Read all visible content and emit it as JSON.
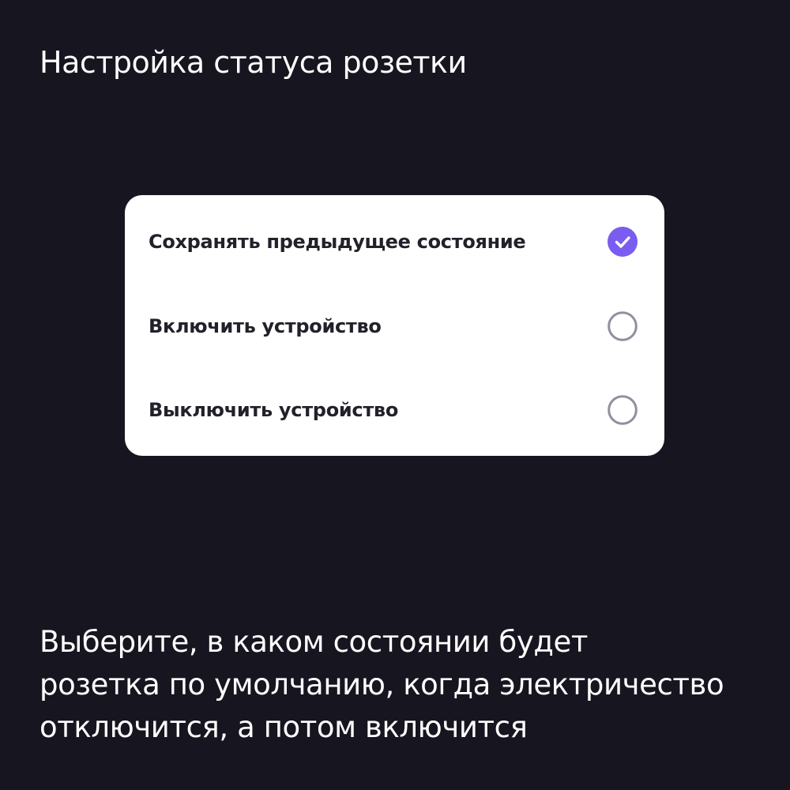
{
  "header": {
    "title": "Настройка статуса розетки"
  },
  "options": [
    {
      "label": "Сохранять предыдущее состояние",
      "selected": true
    },
    {
      "label": "Включить устройство",
      "selected": false
    },
    {
      "label": "Выключить устройство",
      "selected": false
    }
  ],
  "description": {
    "lines": [
      "Выберите, в каком состоянии будет",
      "розетка по умолчанию, когда электричество",
      "отключится, а потом включится"
    ]
  },
  "colors": {
    "background": "#17151f",
    "card": "#ffffff",
    "accent": "#7a5cf0",
    "radio_border": "#8e919e",
    "option_text": "#22212a"
  },
  "icons": {
    "selected": "check-circle-icon",
    "unselected": "radio-empty-icon"
  }
}
